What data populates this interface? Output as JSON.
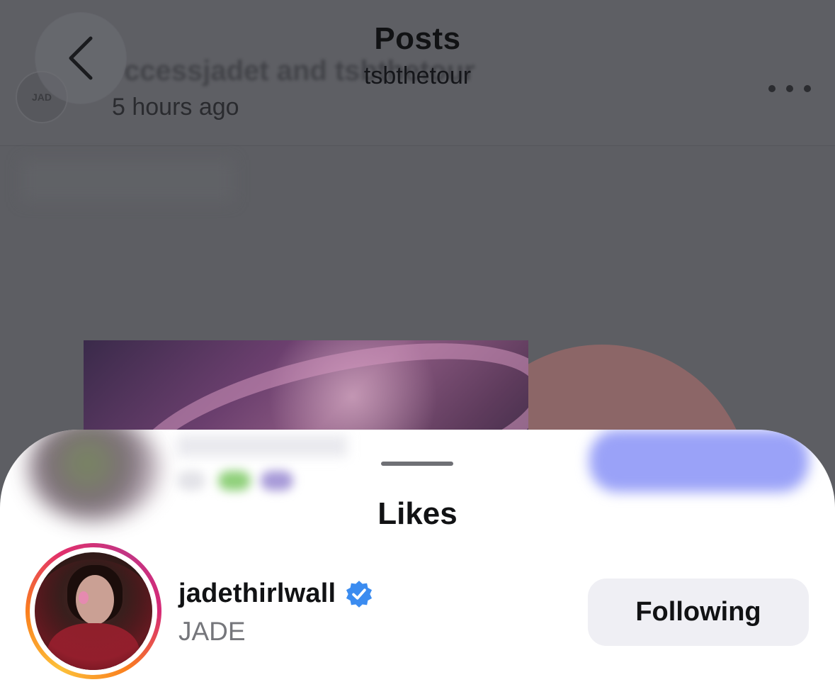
{
  "header": {
    "title": "Posts",
    "subtitle": "tsbthetour"
  },
  "post": {
    "authors_text": "ccessjadet and tsbthetour",
    "avatar_text": "JAD",
    "time": "5 hours ago",
    "more_icon": "ellipsis-horizontal-icon"
  },
  "likes_sheet": {
    "title": "Likes",
    "entries": [
      {
        "username": "jadethirlwall",
        "display_name": "JADE",
        "verified": true,
        "button_label": "Following"
      }
    ]
  },
  "colors": {
    "verified_blue": "#3b8cf0",
    "sheet_background": "#ffffff",
    "dim_overlay": "#5d5e63",
    "button_gray": "#efeff4"
  }
}
